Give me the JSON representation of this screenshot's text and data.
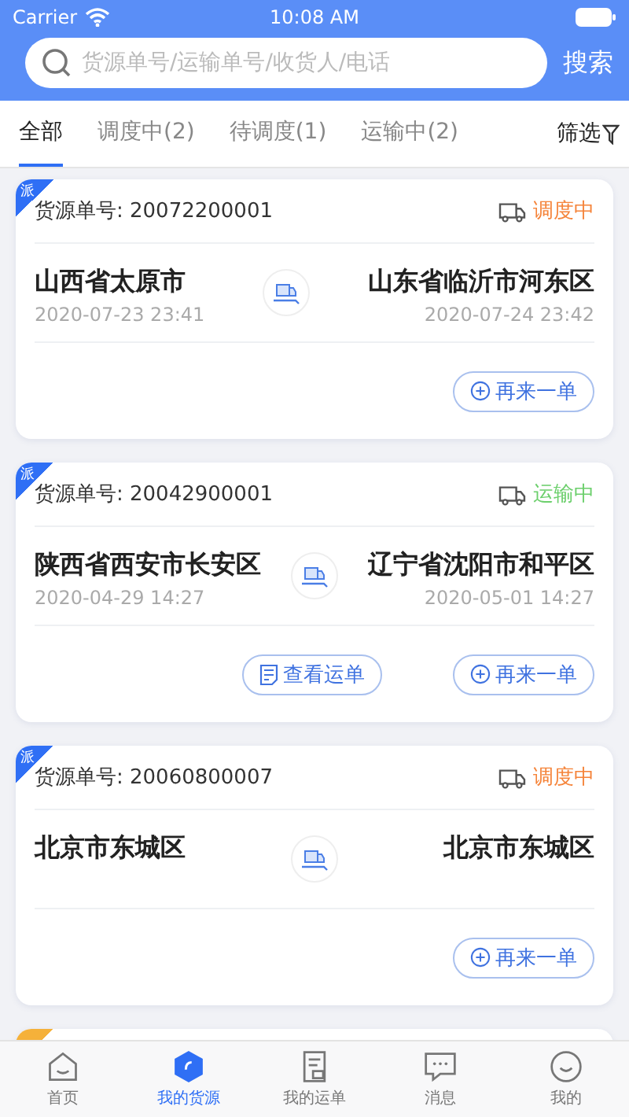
{
  "status_bar": {
    "carrier": "Carrier",
    "time": "10:08 AM"
  },
  "search": {
    "placeholder": "货源单号/运输单号/收货人/电话",
    "button": "搜索"
  },
  "tabs": [
    {
      "label": "全部",
      "selected": true
    },
    {
      "label": "调度中(2)",
      "selected": false
    },
    {
      "label": "待调度(1)",
      "selected": false
    },
    {
      "label": "运输中(2)",
      "selected": false
    }
  ],
  "filter": "筛选",
  "cards": [
    {
      "kind": "full",
      "tag": {
        "text": "派",
        "color": "#2f6ff5"
      },
      "order_no": "货源单号: 20072200001",
      "status": {
        "text": "调度中",
        "color": "#f5843a"
      },
      "from": {
        "city": "山西省太原市",
        "time": "2020-07-23 23:41"
      },
      "to": {
        "city": "山东省临沂市河东区",
        "time": "2020-07-24 23:42"
      },
      "buttons": [
        {
          "kind": "reorder",
          "label": "再来一单"
        }
      ]
    },
    {
      "kind": "full",
      "tag": {
        "text": "派",
        "color": "#2f6ff5"
      },
      "order_no": "货源单号: 20042900001",
      "status": {
        "text": "运输中",
        "color": "#6ccf6c"
      },
      "from": {
        "city": "陕西省西安市长安区",
        "time": "2020-04-29 14:27"
      },
      "to": {
        "city": "辽宁省沈阳市和平区",
        "time": "2020-05-01 14:27"
      },
      "buttons": [
        {
          "kind": "waybill",
          "label": "查看运单"
        },
        {
          "kind": "reorder",
          "label": "再来一单"
        }
      ]
    },
    {
      "kind": "full",
      "tag": {
        "text": "派",
        "color": "#2f6ff5"
      },
      "order_no": "货源单号: 20060800007",
      "status": {
        "text": "调度中",
        "color": "#f5843a"
      },
      "from": {
        "city": "北京市东城区"
      },
      "to": {
        "city": "北京市东城区"
      },
      "buttons": [
        {
          "kind": "reorder",
          "label": "再来一单"
        }
      ]
    },
    {
      "kind": "peek",
      "tag": {
        "color": "#f5b13a"
      }
    }
  ],
  "nav": [
    {
      "kind": "home",
      "label": "首页",
      "selected": false
    },
    {
      "kind": "goods",
      "label": "我的货源",
      "selected": true
    },
    {
      "kind": "waybill",
      "label": "我的运单",
      "selected": false
    },
    {
      "kind": "message",
      "label": "消息",
      "selected": false
    },
    {
      "kind": "me",
      "label": "我的",
      "selected": false
    }
  ]
}
